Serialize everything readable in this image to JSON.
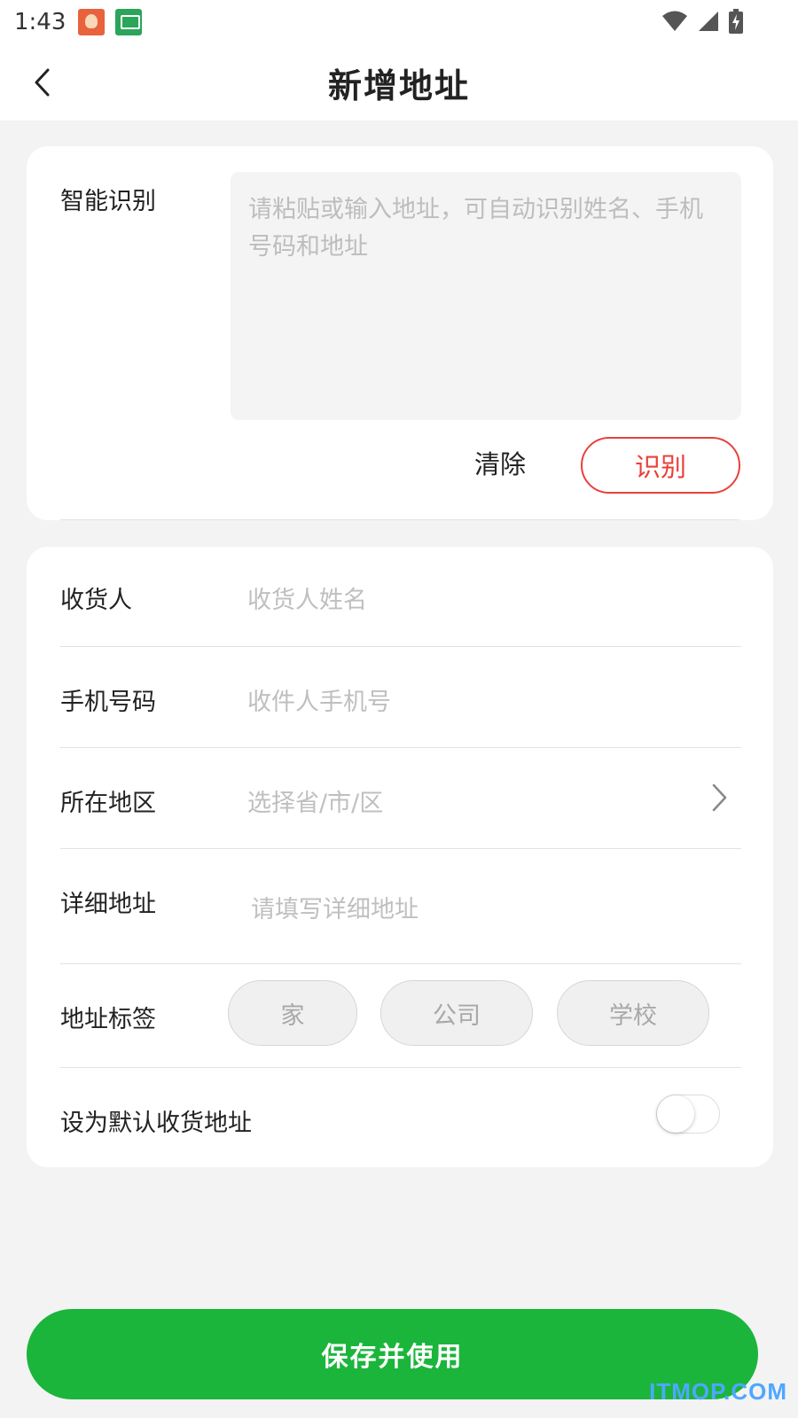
{
  "status_bar": {
    "time": "1:43"
  },
  "header": {
    "title": "新增地址"
  },
  "smart_recognition": {
    "label": "智能识别",
    "placeholder": "请粘贴或输入地址，可自动识别姓名、手机号码和地址",
    "clear_label": "清除",
    "recognize_label": "识别"
  },
  "form": {
    "recipient": {
      "label": "收货人",
      "placeholder": "收货人姓名"
    },
    "phone": {
      "label": "手机号码",
      "placeholder": "收件人手机号"
    },
    "region": {
      "label": "所在地区",
      "placeholder": "选择省/市/区"
    },
    "detail": {
      "label": "详细地址",
      "placeholder": "请填写详细地址"
    },
    "tags": {
      "label": "地址标签",
      "options": [
        "家",
        "公司",
        "学校"
      ]
    },
    "default": {
      "label": "设为默认收货地址",
      "enabled": false
    }
  },
  "actions": {
    "save_label": "保存并使用"
  },
  "watermark": "ITMOP.COM",
  "colors": {
    "accent_green": "#1bb53c",
    "recognize_red": "#e8413a",
    "watermark_blue": "#4fa7ff"
  }
}
